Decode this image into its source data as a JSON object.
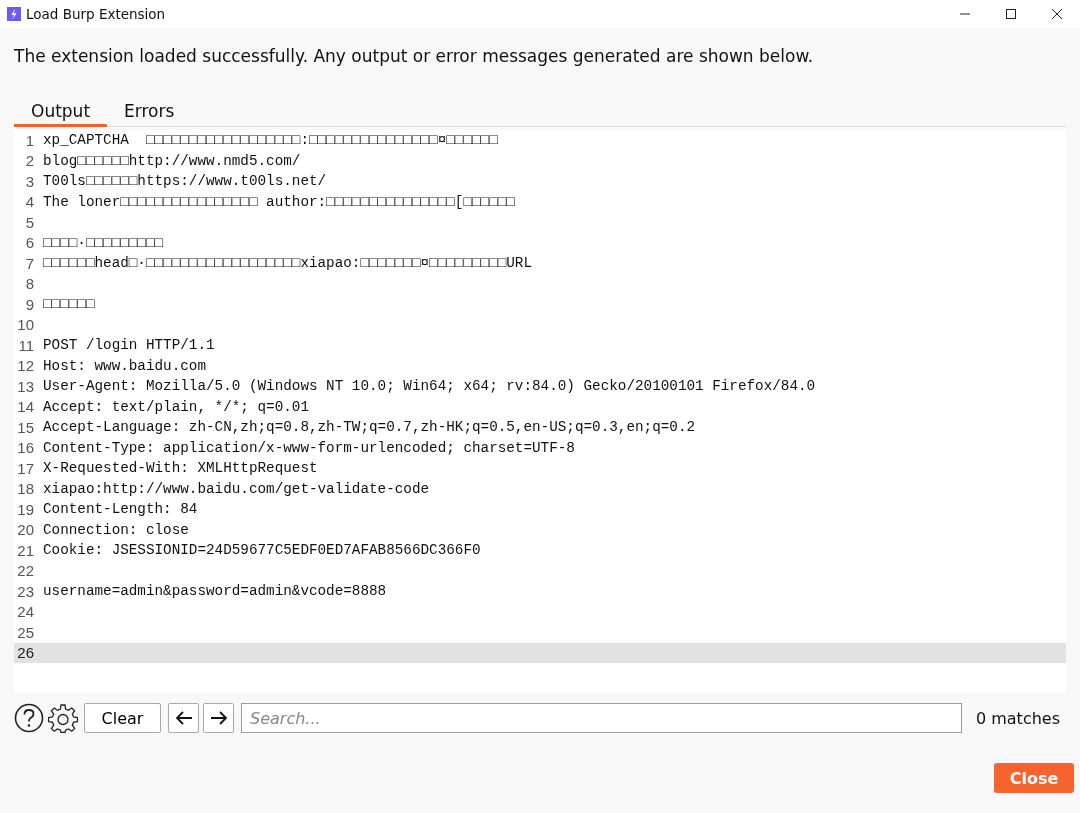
{
  "window": {
    "title": "Load Burp Extension"
  },
  "message": "The extension loaded successfully. Any output or error messages generated are shown below.",
  "tabs": [
    {
      "label": "Output",
      "selected": true
    },
    {
      "label": "Errors",
      "selected": false
    }
  ],
  "lines": [
    {
      "number": "1",
      "text": "xp_CAPTCHA  □□□□□□□□□□□□□□□□□□:□□□□□□□□□□□□□□□¤□□□□□□",
      "current": false
    },
    {
      "number": "2",
      "text": "blog□□□□□□http://www.nmd5.com/",
      "current": false
    },
    {
      "number": "3",
      "text": "T00ls□□□□□□https://www.t00ls.net/",
      "current": false
    },
    {
      "number": "4",
      "text": "The loner□□□□□□□□□□□□□□□□ author:□□□□□□□□□□□□□□□[□□□□□□",
      "current": false
    },
    {
      "number": "5",
      "current": false
    },
    {
      "number": "6",
      "text": "□□□□·□□□□□□□□□",
      "current": false
    },
    {
      "number": "7",
      "text": "□□□□□□head□·□□□□□□□□□□□□□□□□□□xiapao:□□□□□□□¤□□□□□□□□□URL",
      "current": false
    },
    {
      "number": "8",
      "current": false
    },
    {
      "number": "9",
      "text": "□□□□□□",
      "current": false
    },
    {
      "number": "10",
      "current": false
    },
    {
      "number": "11",
      "text": "POST /login HTTP/1.1",
      "current": false
    },
    {
      "number": "12",
      "text": "Host: www.baidu.com",
      "current": false
    },
    {
      "number": "13",
      "text": "User-Agent: Mozilla/5.0 (Windows NT 10.0; Win64; x64; rv:84.0) Gecko/20100101 Firefox/84.0",
      "current": false
    },
    {
      "number": "14",
      "text": "Accept: text/plain, */*; q=0.01",
      "current": false
    },
    {
      "number": "15",
      "text": "Accept-Language: zh-CN,zh;q=0.8,zh-TW;q=0.7,zh-HK;q=0.5,en-US;q=0.3,en;q=0.2",
      "current": false
    },
    {
      "number": "16",
      "text": "Content-Type: application/x-www-form-urlencoded; charset=UTF-8",
      "current": false
    },
    {
      "number": "17",
      "text": "X-Requested-With: XMLHttpRequest",
      "current": false
    },
    {
      "number": "18",
      "text": "xiapao:http://www.baidu.com/get-validate-code",
      "current": false
    },
    {
      "number": "19",
      "text": "Content-Length: 84",
      "current": false
    },
    {
      "number": "20",
      "text": "Connection: close",
      "current": false
    },
    {
      "number": "21",
      "text": "Cookie: JSESSIONID=24D59677C5EDF0ED7AFAB8566DC366F0",
      "current": false
    },
    {
      "number": "22",
      "current": false
    },
    {
      "number": "23",
      "text": "username=admin&password=admin&vcode=8888",
      "current": false
    },
    {
      "number": "24",
      "current": false
    },
    {
      "number": "25",
      "current": false
    },
    {
      "number": "26",
      "current": true
    }
  ],
  "toolbar": {
    "clear_button": "Clear",
    "search": {
      "placeholder": "Search..."
    },
    "matches": "0 matches"
  },
  "close_button": "Close"
}
